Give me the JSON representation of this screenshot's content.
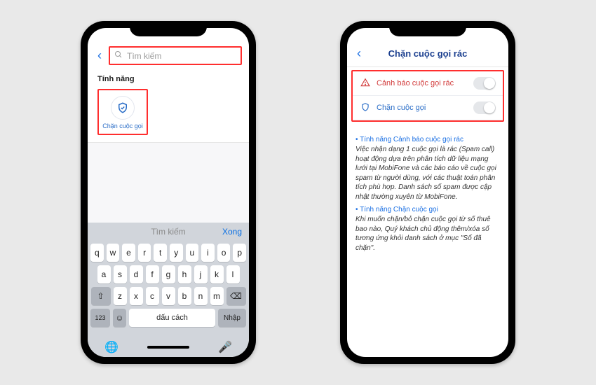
{
  "left": {
    "search_placeholder": "Tìm kiếm",
    "section_title": "Tính năng",
    "tile_label": "Chặn cuộc gọi",
    "kb_hint": "Tìm kiếm",
    "kb_done": "Xong",
    "rows": {
      "r1": [
        "q",
        "w",
        "e",
        "r",
        "t",
        "y",
        "u",
        "i",
        "o",
        "p"
      ],
      "r2": [
        "a",
        "s",
        "d",
        "f",
        "g",
        "h",
        "j",
        "k",
        "l"
      ],
      "r3": [
        "z",
        "x",
        "c",
        "v",
        "b",
        "n",
        "m"
      ]
    },
    "key_123": "123",
    "key_space": "dấu cách",
    "key_return": "Nhập"
  },
  "right": {
    "title": "Chặn cuộc gọi rác",
    "row1": "Cảnh báo cuộc gọi rác",
    "row2": "Chặn cuộc gọi",
    "h1": "• Tính năng Cảnh báo cuộc gọi rác",
    "p1": "Việc nhận dạng 1 cuộc gọi là rác (Spam call) hoạt động dựa trên phân tích dữ liệu mạng lưới tại MobiFone và các báo cáo về cuộc gọi spam từ người dùng, với các thuật toán phân tích phù hợp. Danh sách số spam được cập nhật thường xuyên từ MobiFone.",
    "h2": "• Tính năng Chặn cuộc gọi",
    "p2": "Khi muốn chặn/bỏ chặn cuộc gọi từ số thuê bao nào, Quý khách chủ động thêm/xóa số tương ứng khỏi danh sách ở mục \"Số đã chặn\"."
  }
}
